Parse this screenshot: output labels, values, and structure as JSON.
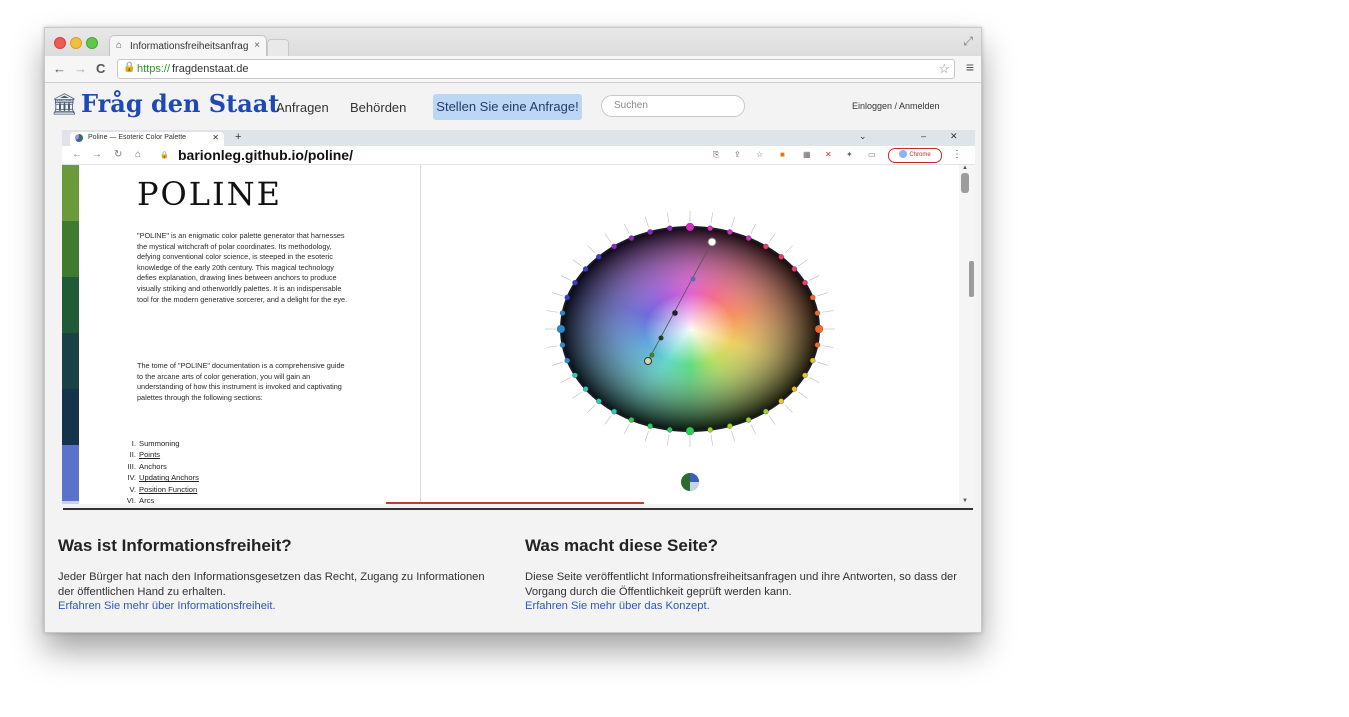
{
  "browser": {
    "tab_title": "Informationsfreiheitsanfrag",
    "url_scheme": "https://",
    "url_rest": "fragdenstaat.de"
  },
  "site_header": {
    "logo_text": "Fråg den Staat",
    "nav": [
      "Anfragen",
      "Behörden"
    ],
    "cta_label": "Stellen Sie eine Anfrage!",
    "search_placeholder": "Suchen",
    "login_label": "Einloggen / Anmelden"
  },
  "inner_browser": {
    "tab_title": "Poline — Esoteric Color Palette",
    "url": "barionleg.github.io/poline/",
    "profile_label": "Chrome"
  },
  "poline": {
    "title": "POLINE",
    "para1": "\"POLINE\" is an enigmatic color palette generator that harnesses the mystical witchcraft of polar coordinates. Its methodology, defying conventional color science, is steeped in the esoteric knowledge of the early 20th century. This magical technology defies explanation, drawing lines between anchors to produce visually striking and otherworldly palettes. It is an indispensable tool for the modern generative sorcerer, and a delight for the eye.",
    "para2": "The tome of \"POLINE\" documentation is a comprehensive guide to the arcane arts of color generation, you will gain an understanding of how this instrument is invoked and captivating palettes through the following sections:",
    "toc": [
      {
        "num": "I.",
        "label": "Summoning"
      },
      {
        "num": "II.",
        "label": "Points"
      },
      {
        "num": "III.",
        "label": "Anchors"
      },
      {
        "num": "IV.",
        "label": "Updating Anchors"
      },
      {
        "num": "V.",
        "label": "Position Function"
      },
      {
        "num": "VI.",
        "label": "Arcs"
      }
    ],
    "swatch_colors": [
      "#6b9a3a",
      "#3f7a2f",
      "#205a36",
      "#1a4245",
      "#15344c",
      "#5a72c8",
      "#c9cfee"
    ]
  },
  "footer_sections": {
    "left": {
      "heading": "Was ist Informationsfreiheit?",
      "text": "Jeder Bürger hat nach den Informationsgesetzen das Recht, Zugang zu Informationen der öffentlichen Hand zu erhalten.",
      "link": "Erfahren Sie mehr über Informationsfreiheit."
    },
    "right": {
      "heading": "Was macht diese Seite?",
      "text": "Diese Seite veröffentlicht Informationsfreiheitsanfragen und ihre Antworten, so dass der Vorgang durch die Öffentlichkeit geprüft werden kann.",
      "link": "Erfahren Sie mehr über das Konzept."
    }
  },
  "colors": {
    "brand_blue": "#1d48b5",
    "cta_bg": "#bcd7f4",
    "link_blue": "#2f56c6"
  }
}
